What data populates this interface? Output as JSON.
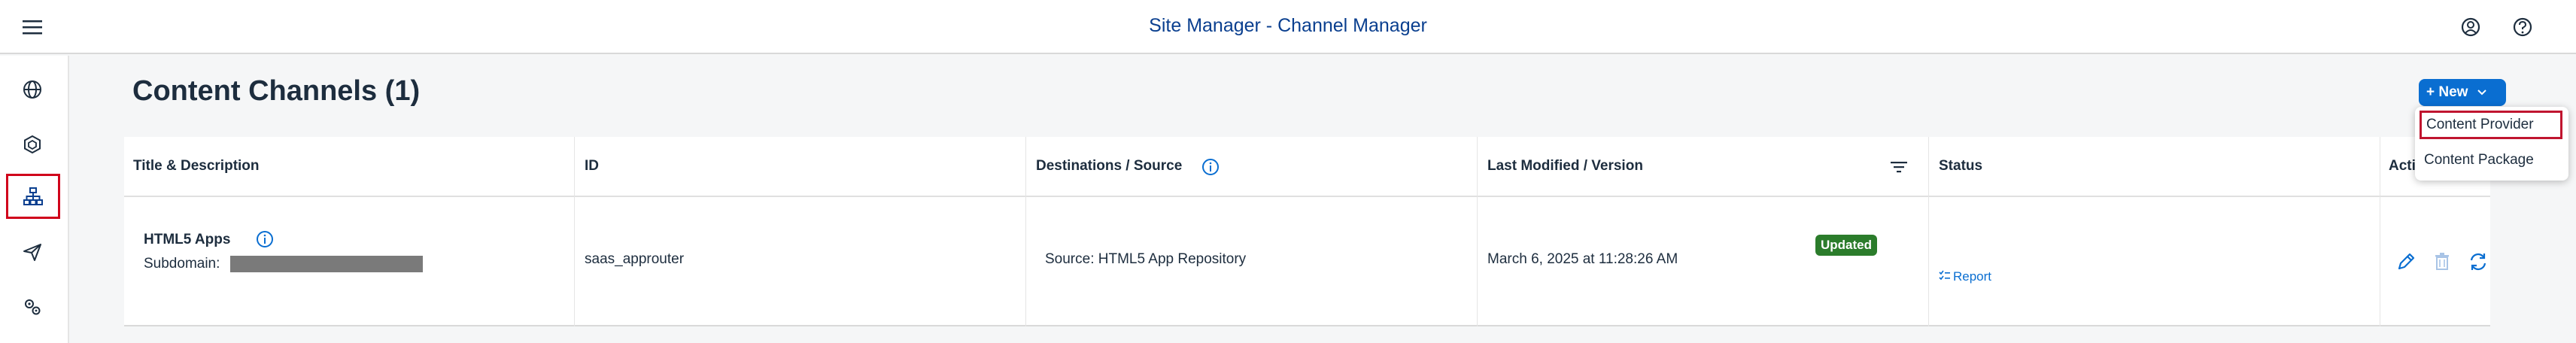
{
  "header": {
    "title": "Site Manager - Channel Manager"
  },
  "icons": {
    "menu": "hamburger-menu-icon",
    "user": "user-account-icon",
    "help": "help-icon",
    "nav": [
      "globe-icon",
      "cube-icon",
      "sitemap-icon",
      "paper-plane-icon",
      "settings-gears-icon"
    ],
    "info": "information-icon",
    "filter": "filter-sort-icon",
    "edit": "edit-pencil-icon",
    "delete": "delete-trash-icon",
    "refresh": "refresh-icon",
    "report": "checklist-icon"
  },
  "page": {
    "title": "Content Channels (1)"
  },
  "toolbar": {
    "new_label": "+ New"
  },
  "new_menu": {
    "items": [
      "Content Provider",
      "Content Package"
    ]
  },
  "table": {
    "columns": [
      "Title & Description",
      "ID",
      "Destinations / Source",
      "Last Modified / Version",
      "Status",
      "Acti"
    ],
    "rows": [
      {
        "title": "HTML5 Apps",
        "subdomain_label": "Subdomain:",
        "id": "saas_approuter",
        "source": "Source: HTML5 App Repository",
        "modified": "March 6, 2025 at 11:28:26 AM",
        "status": "Updated",
        "report": "Report"
      }
    ]
  },
  "colors": {
    "accent": "#0a6ed1",
    "status_success": "#2b7c2b",
    "highlight": "#d0021b",
    "title_blue": "#0a3f8f"
  }
}
